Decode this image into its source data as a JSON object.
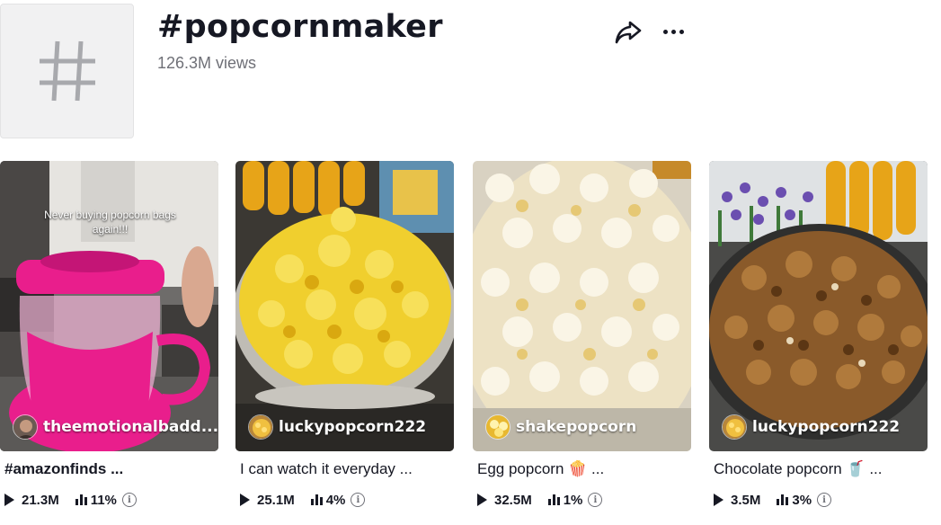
{
  "hashtag": {
    "title": "#popcornmaker",
    "views": "126.3M views",
    "icon": "hashtag-icon"
  },
  "actions": {
    "share_icon": "share-icon",
    "more_icon": "more-options-icon"
  },
  "videos": [
    {
      "overlay_text": "Never buying popcorn bags again!!!",
      "author": "theemotionalbadd...",
      "description": "#amazonfinds ...",
      "views": "21.3M",
      "engagement": "11%"
    },
    {
      "overlay_text": "",
      "author": "luckypopcorn222",
      "description": "I can watch it everyday ...",
      "views": "25.1M",
      "engagement": "4%"
    },
    {
      "overlay_text": "",
      "author": "shakepopcorn",
      "description": "Egg popcorn 🍿 ...",
      "views": "32.5M",
      "engagement": "1%"
    },
    {
      "overlay_text": "",
      "author": "luckypopcorn222",
      "description": "Chocolate popcorn 🥤 ...",
      "views": "3.5M",
      "engagement": "3%"
    }
  ],
  "colors": {
    "text": "#161823",
    "secondary_text": "#6f7077",
    "tag_avatar_bg": "#f1f1f2",
    "popper_pink": "#e91e8c"
  }
}
